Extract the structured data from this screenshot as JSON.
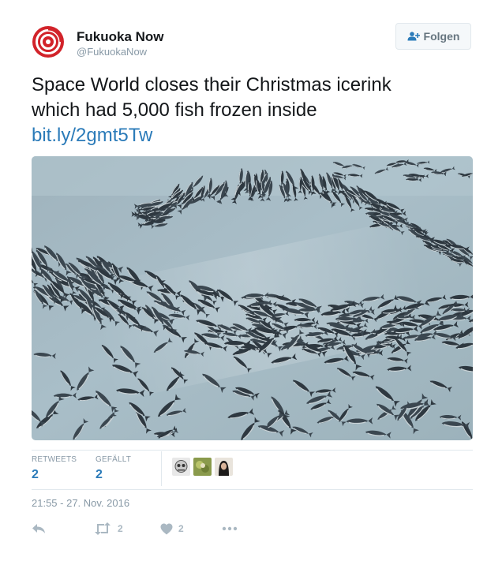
{
  "author": {
    "name": "Fukuoka Now",
    "handle": "@FukuokaNow",
    "avatar_icon": "fukuoka-now-logo-icon",
    "brand_color": "#d2232a"
  },
  "follow_button": {
    "label": "Folgen",
    "icon": "add-user-icon"
  },
  "tweet": {
    "text_lines": [
      "Space World closes their Christmas icerink",
      "which had 5,000 fish frozen inside"
    ],
    "link": "bit.ly/2gmt5Tw",
    "link_color": "#2b7bb9"
  },
  "stats": {
    "retweets_label": "RETWEETS",
    "retweets_count": "2",
    "likes_label": "GEFÄLLT",
    "likes_count": "2"
  },
  "likers": [
    "liker-avatar-1",
    "liker-avatar-2",
    "liker-avatar-3"
  ],
  "timestamp": "21:55 - 27. Nov. 2016",
  "actions": {
    "reply_icon": "reply-icon",
    "retweet_icon": "retweet-icon",
    "retweet_count": "2",
    "like_icon": "heart-icon",
    "like_count": "2",
    "more_icon": "more-dots-icon"
  }
}
